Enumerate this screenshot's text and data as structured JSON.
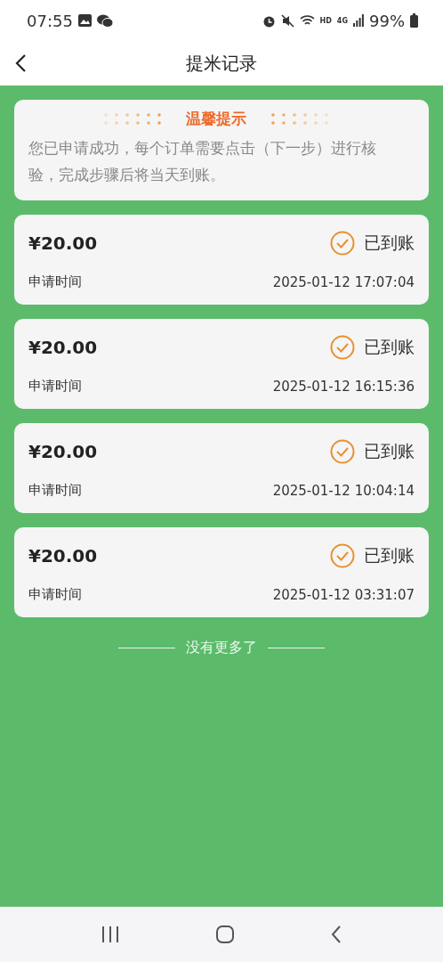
{
  "status_bar": {
    "time": "07:55",
    "network_label": "HD",
    "cell_label": "4G",
    "battery": "99%"
  },
  "header": {
    "title": "提米记录"
  },
  "notice": {
    "title": "温馨提示",
    "text": "您已申请成功，每个订单需要点击（下一步）进行核验，完成步骤后将当天到账。"
  },
  "records": [
    {
      "amount": "¥20.00",
      "status": "已到账",
      "received": true,
      "time_label": "申请时间",
      "time": "2025-01-12 17:07:04"
    },
    {
      "amount": "¥20.00",
      "status": "已到账",
      "received": true,
      "time_label": "申请时间",
      "time": "2025-01-12 16:15:36"
    },
    {
      "amount": "¥20.00",
      "status": "已到账",
      "received": true,
      "time_label": "申请时间",
      "time": "2025-01-12 10:04:14"
    },
    {
      "amount": "¥20.00",
      "status": "已到账",
      "received": true,
      "time_label": "申请时间",
      "time": "2025-01-12 03:31:07"
    }
  ],
  "end_text": "没有更多了"
}
